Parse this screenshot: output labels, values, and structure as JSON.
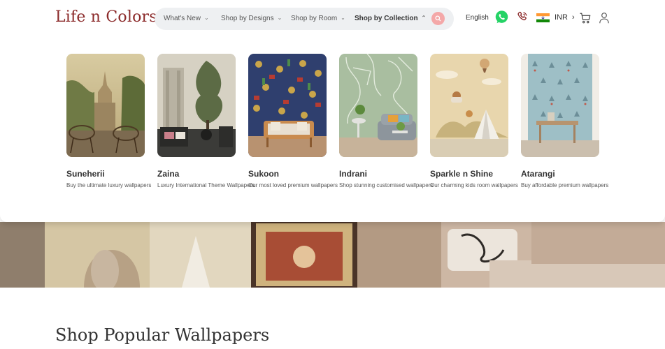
{
  "brand": {
    "logo": "Life n Colors"
  },
  "nav": {
    "items": [
      {
        "label": "What's New"
      },
      {
        "label": "Shop by Designs"
      },
      {
        "label": "Shop by Room"
      },
      {
        "label": "Shop by Collection",
        "active": true
      }
    ]
  },
  "header": {
    "language": "English",
    "currency": "INR",
    "currency_chevron": "›"
  },
  "collections": [
    {
      "name": "Suneherii",
      "desc": "Buy the ultimate luxury wallpapers"
    },
    {
      "name": "Zaina",
      "desc": "Luxury International Theme Wallpapers"
    },
    {
      "name": "Sukoon",
      "desc": "Our most loved premium wallpapers"
    },
    {
      "name": "Indrani",
      "desc": "Shop stunning customised wallpapers"
    },
    {
      "name": "Sparkle n Shine",
      "desc": "Our charming kids room wallpapers"
    },
    {
      "name": "Atarangi",
      "desc": "Buy affordable premium wallpapers"
    }
  ],
  "section": {
    "title": "Shop Popular Wallpapers"
  },
  "colors": {
    "brand": "#8b2a2a",
    "whatsapp": "#25d366",
    "search_accent": "#f4a8a8"
  },
  "icons": [
    "chevron-down-icon",
    "search-icon",
    "whatsapp-icon",
    "phone-icon",
    "india-flag-icon",
    "cart-icon",
    "user-icon"
  ]
}
